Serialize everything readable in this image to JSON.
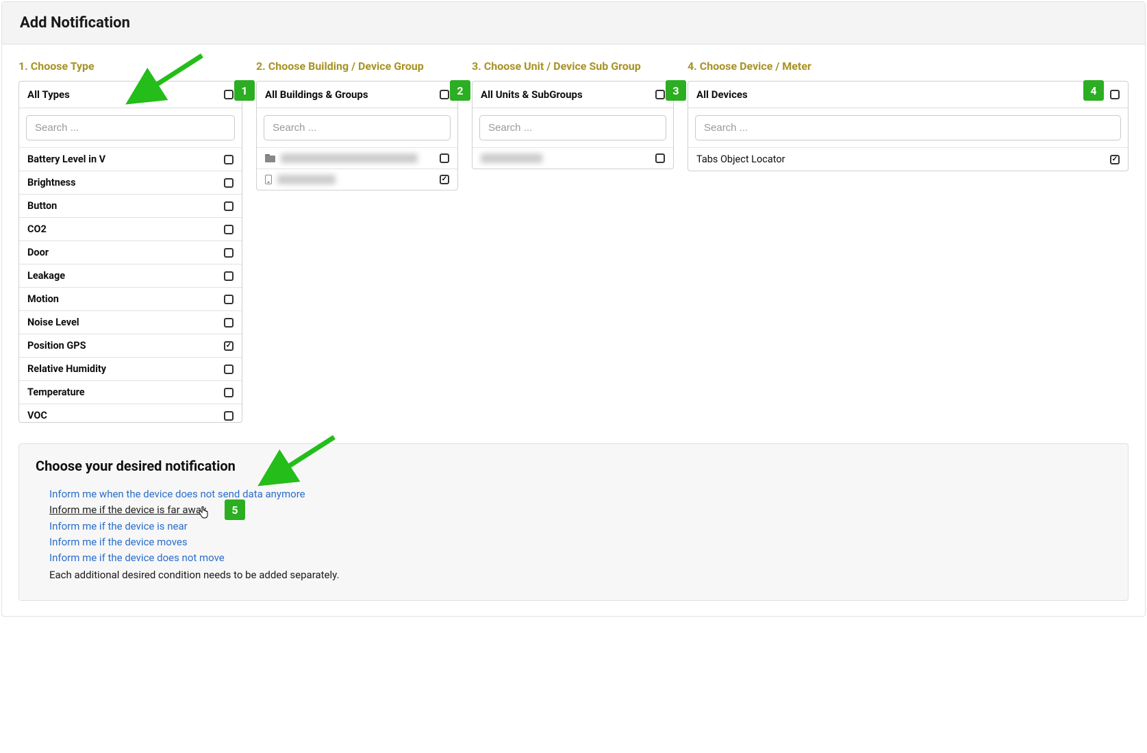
{
  "page_title": "Add Notification",
  "steps": {
    "s1": {
      "label": "1. Choose Type",
      "panel_title": "All Types",
      "search_placeholder": "Search ..."
    },
    "s2": {
      "label": "2. Choose Building / Device Group",
      "panel_title": "All Buildings & Groups",
      "search_placeholder": "Search ..."
    },
    "s3": {
      "label": "3. Choose Unit / Device Sub Group",
      "panel_title": "All Units & SubGroups",
      "search_placeholder": "Search ..."
    },
    "s4": {
      "label": "4. Choose Device / Meter",
      "panel_title": "All Devices",
      "search_placeholder": "Search ..."
    }
  },
  "types": [
    {
      "label": "Battery Level in V",
      "checked": false
    },
    {
      "label": "Brightness",
      "checked": false
    },
    {
      "label": "Button",
      "checked": false
    },
    {
      "label": "CO2",
      "checked": false
    },
    {
      "label": "Door",
      "checked": false
    },
    {
      "label": "Leakage",
      "checked": false
    },
    {
      "label": "Motion",
      "checked": false
    },
    {
      "label": "Noise Level",
      "checked": false
    },
    {
      "label": "Position GPS",
      "checked": true
    },
    {
      "label": "Relative Humidity",
      "checked": false
    },
    {
      "label": "Temperature",
      "checked": false
    },
    {
      "label": "VOC",
      "checked": false
    }
  ],
  "devices": {
    "item0": {
      "label": "Tabs Object Locator",
      "checked": true
    }
  },
  "buildings": {
    "item0_checked": false,
    "item1_checked": true
  },
  "units": {
    "item0_checked": false
  },
  "badges": {
    "b1": "1",
    "b2": "2",
    "b3": "3",
    "b4": "4",
    "b5": "5"
  },
  "notifications": {
    "title": "Choose your desired notification",
    "links": {
      "l0": "Inform me when the device does not send data anymore",
      "l1": "Inform me if the device is far away",
      "l2": "Inform me if the device is near",
      "l3": "Inform me if the device moves",
      "l4": "Inform me if the device does not move"
    },
    "note": "Each additional desired condition needs to be added separately."
  }
}
